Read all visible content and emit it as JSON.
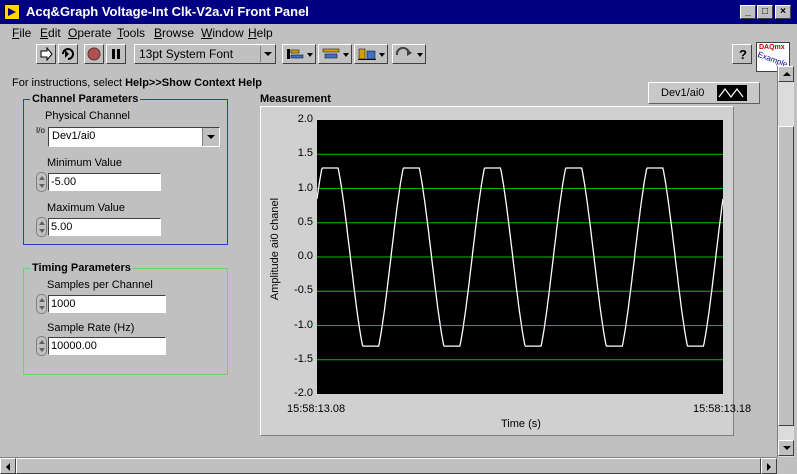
{
  "window": {
    "title": "Acq&Graph Voltage-Int Clk-V2a.vi Front Panel",
    "buttons": {
      "minimize": "_",
      "maximize": "□",
      "close": "×"
    }
  },
  "menu": [
    {
      "label": "File",
      "key": "F",
      "rest": "ile"
    },
    {
      "label": "Edit",
      "key": "E",
      "rest": "dit"
    },
    {
      "label": "Operate",
      "key": "O",
      "rest": "perate"
    },
    {
      "label": "Tools",
      "key": "T",
      "rest": "ools"
    },
    {
      "label": "Browse",
      "key": "B",
      "rest": "rowse"
    },
    {
      "label": "Window",
      "key": "W",
      "rest": "indow"
    },
    {
      "label": "Help",
      "key": "H",
      "rest": "elp"
    }
  ],
  "toolbar": {
    "font": "13pt System Font",
    "help_button": "?",
    "daqmx_badge_top": "DAQmx",
    "daqmx_badge_bottom": "Example"
  },
  "instructions": {
    "prefix": "For instructions, select ",
    "bold": "Help>>Show Context Help"
  },
  "channel_params": {
    "title": "Channel Parameters",
    "physical_channel_label": "Physical Channel",
    "physical_channel_value": "Dev1/ai0",
    "io_glyph": "I/o",
    "min_label": "Minimum Value",
    "min_value": "-5.00",
    "max_label": "Maximum Value",
    "max_value": "5.00"
  },
  "timing_params": {
    "title": "Timing Parameters",
    "samples_label": "Samples per Channel",
    "samples_value": "1000",
    "rate_label": "Sample Rate (Hz)",
    "rate_value": "10000.00"
  },
  "graph": {
    "title": "Measurement",
    "legend_label": "Dev1/ai0",
    "ylabel": "Amplitude ai0 chanel",
    "xlabel": "Time (s)",
    "x_start": "15:58:13.08",
    "x_end": "15:58:13.18",
    "y_ticks": [
      "2.0",
      "1.5",
      "1.0",
      "0.5",
      "0.0",
      "-0.5",
      "-1.0",
      "-1.5",
      "-2.0"
    ],
    "colors": {
      "plot_bg": "#000000",
      "grid": "#00c000",
      "trace": "#ffffff"
    }
  },
  "chart_data": {
    "type": "line",
    "title": "Measurement",
    "xlabel": "Time (s)",
    "ylabel": "Amplitude ai0 chanel",
    "ylim": [
      -2.0,
      2.0
    ],
    "x_range_labels": [
      "15:58:13.08",
      "15:58:13.18"
    ],
    "series": [
      {
        "name": "Dev1/ai0",
        "shape": "clipped sine",
        "cycles": 5,
        "amplitude_peak": 1.3,
        "amplitude_trough": -1.3,
        "start_value": 0.85
      }
    ],
    "grid": true,
    "legend": "top-right"
  }
}
